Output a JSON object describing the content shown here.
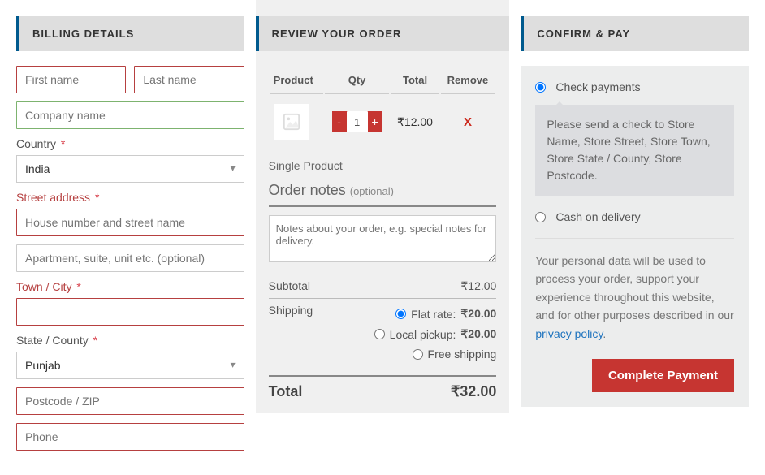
{
  "billing": {
    "title": "BILLING DETAILS",
    "first_name_ph": "First name",
    "last_name_ph": "Last name",
    "company_ph": "Company name",
    "country_label": "Country",
    "country_value": "India",
    "street_label": "Street address",
    "street_ph": "House number and street name",
    "apt_ph": "Apartment, suite, unit etc. (optional)",
    "town_label": "Town / City",
    "state_label": "State / County",
    "state_value": "Punjab",
    "postcode_ph": "Postcode / ZIP",
    "phone_ph": "Phone",
    "required_mark": "*"
  },
  "review": {
    "title": "REVIEW YOUR ORDER",
    "headers": {
      "product": "Product",
      "qty": "Qty",
      "total": "Total",
      "remove": "Remove"
    },
    "item": {
      "name": "Single Product",
      "qty": "1",
      "total": "₹12.00",
      "remove": "X"
    },
    "order_notes_label": "Order notes",
    "order_notes_optional": "(optional)",
    "order_notes_ph": "Notes about your order, e.g. special notes for delivery.",
    "subtotal_label": "Subtotal",
    "subtotal_value": "₹12.00",
    "shipping_label": "Shipping",
    "shipping_options": {
      "flat": {
        "label": "Flat rate:",
        "value": "₹20.00"
      },
      "local": {
        "label": "Local pickup:",
        "value": "₹20.00"
      },
      "free": {
        "label": "Free shipping"
      }
    },
    "total_label": "Total",
    "total_value": "₹32.00"
  },
  "confirm": {
    "title": "CONFIRM & PAY",
    "methods": {
      "check": "Check payments",
      "check_desc": "Please send a check to Store Name, Store Street, Store Town, Store State / County, Store Postcode.",
      "cod": "Cash on delivery"
    },
    "privacy_text": "Your personal data will be used to process your order, support your experience throughout this website, and for other purposes described in our ",
    "privacy_link": "privacy policy",
    "privacy_period": ".",
    "button": "Complete Payment"
  }
}
